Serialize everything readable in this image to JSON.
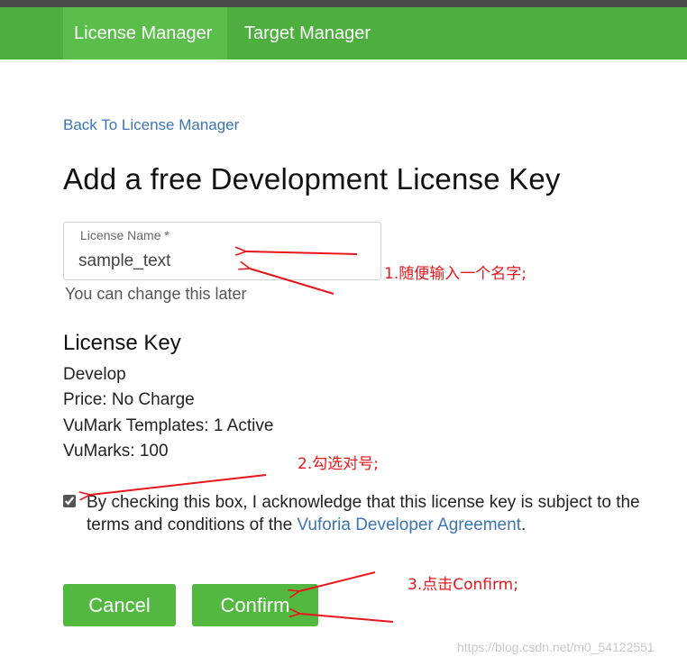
{
  "nav": {
    "tabs": [
      {
        "label": "License Manager",
        "active": true
      },
      {
        "label": "Target Manager",
        "active": false
      }
    ]
  },
  "back_link": "Back To License Manager",
  "title": "Add a free Development License Key",
  "license_name": {
    "label": "License Name *",
    "value": "sample_text",
    "help": "You can change this later"
  },
  "license_key": {
    "heading": "License Key",
    "lines": [
      "Develop",
      "Price: No Charge",
      "VuMark Templates: 1 Active",
      "VuMarks: 100"
    ]
  },
  "agreement": {
    "checked": true,
    "text_before": "By checking this box, I acknowledge that this license key is subject to the terms and conditions of the ",
    "link_text": "Vuforia Developer Agreement",
    "text_after": "."
  },
  "buttons": {
    "cancel": "Cancel",
    "confirm": "Confirm"
  },
  "annotations": {
    "step1": "1.随便输入一个名字;",
    "step2": "2.勾选对号;",
    "step3": "3.点击Confirm;",
    "color": "#e8161b"
  },
  "watermark": "https://blog.csdn.net/m0_54122551",
  "colors": {
    "nav_bg": "#4caf3e",
    "nav_active": "#5bbd4a",
    "button": "#53b840",
    "link": "#3c74b4"
  }
}
